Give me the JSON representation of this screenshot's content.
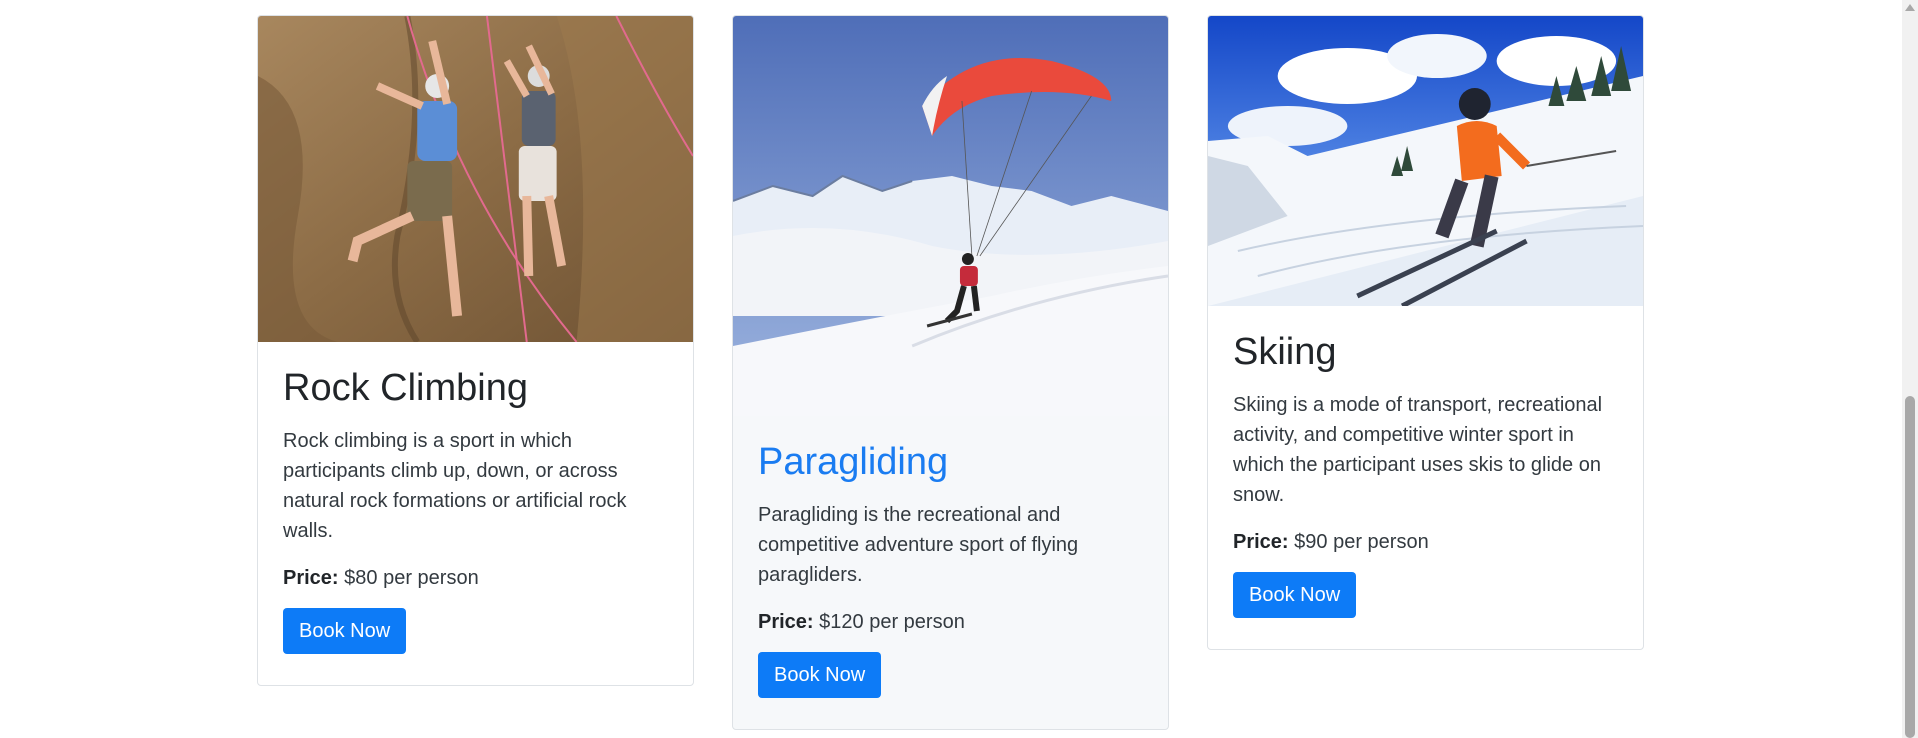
{
  "activities": [
    {
      "title": "Rock Climbing",
      "description": "Rock climbing is a sport in which participants climb up, down, or across natural rock formations or artificial rock walls.",
      "price_label": "Price:",
      "price_value": "$80 per person",
      "button_label": "Book Now"
    },
    {
      "title": "Paragliding",
      "description": "Paragliding is the recreational and competitive adventure sport of flying paragliders.",
      "price_label": "Price:",
      "price_value": "$120 per person",
      "button_label": "Book Now"
    },
    {
      "title": "Skiing",
      "description": "Skiing is a mode of transport, recreational activity, and competitive winter sport in which the participant uses skis to glide on snow.",
      "price_label": "Price:",
      "price_value": "$90 per person",
      "button_label": "Book Now"
    }
  ],
  "colors": {
    "primary_button": "#0d7bf7",
    "active_title": "#1a7cf1",
    "active_card_bg": "#f6f8fa"
  }
}
